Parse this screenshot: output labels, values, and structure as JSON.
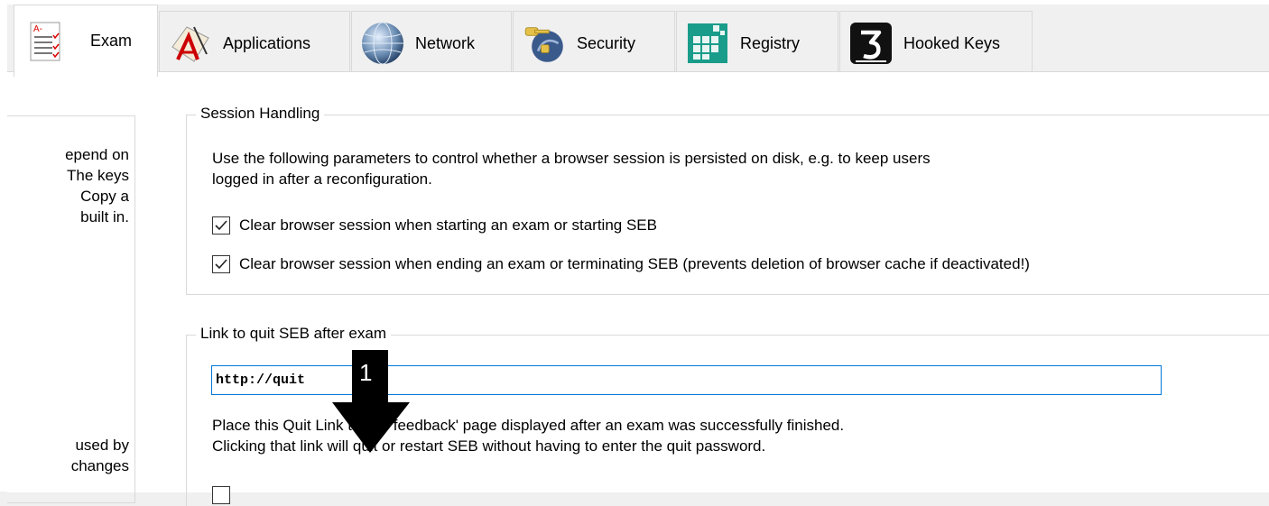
{
  "tabs": [
    {
      "label": "Exam",
      "icon": "exam-sheet-icon",
      "active": true
    },
    {
      "label": "Applications",
      "icon": "applications-icon",
      "active": false
    },
    {
      "label": "Network",
      "icon": "network-globe-icon",
      "active": false
    },
    {
      "label": "Security",
      "icon": "security-keys-icon",
      "active": false
    },
    {
      "label": "Registry",
      "icon": "registry-cubes-icon",
      "active": false
    },
    {
      "label": "Hooked Keys",
      "icon": "hooked-keys-icon",
      "active": false
    }
  ],
  "left_fragments": {
    "top_lines": [
      "epend on",
      "The keys",
      "Copy a",
      "built in."
    ],
    "bottom_lines": [
      "used by",
      "changes"
    ]
  },
  "session": {
    "title": "Session Handling",
    "description_line1": "Use the following parameters to control whether a browser session is persisted on disk, e.g. to keep users",
    "description_line2": "logged in after a reconfiguration.",
    "check1_label": "Clear browser session when starting an exam or starting SEB",
    "check1_checked": true,
    "check2_label": "Clear browser session when ending an exam or terminating SEB (prevents deletion of browser cache if deactivated!)",
    "check2_checked": true
  },
  "quit_link": {
    "title": "Link to quit SEB after exam",
    "value": "http://quit",
    "description_line1": "Place this Quit Link to the 'feedback' page displayed after an exam was successfully finished.",
    "description_line2": "Clicking that link will quit or restart SEB without having to enter the quit password."
  },
  "callout": {
    "number": "1",
    "icon": "down-arrow-callout-icon"
  },
  "colors": {
    "accent_border": "#0078d7",
    "group_border": "#d9d9d9",
    "pane_background": "#ffffff",
    "tab_background": "#f0f0f0"
  }
}
